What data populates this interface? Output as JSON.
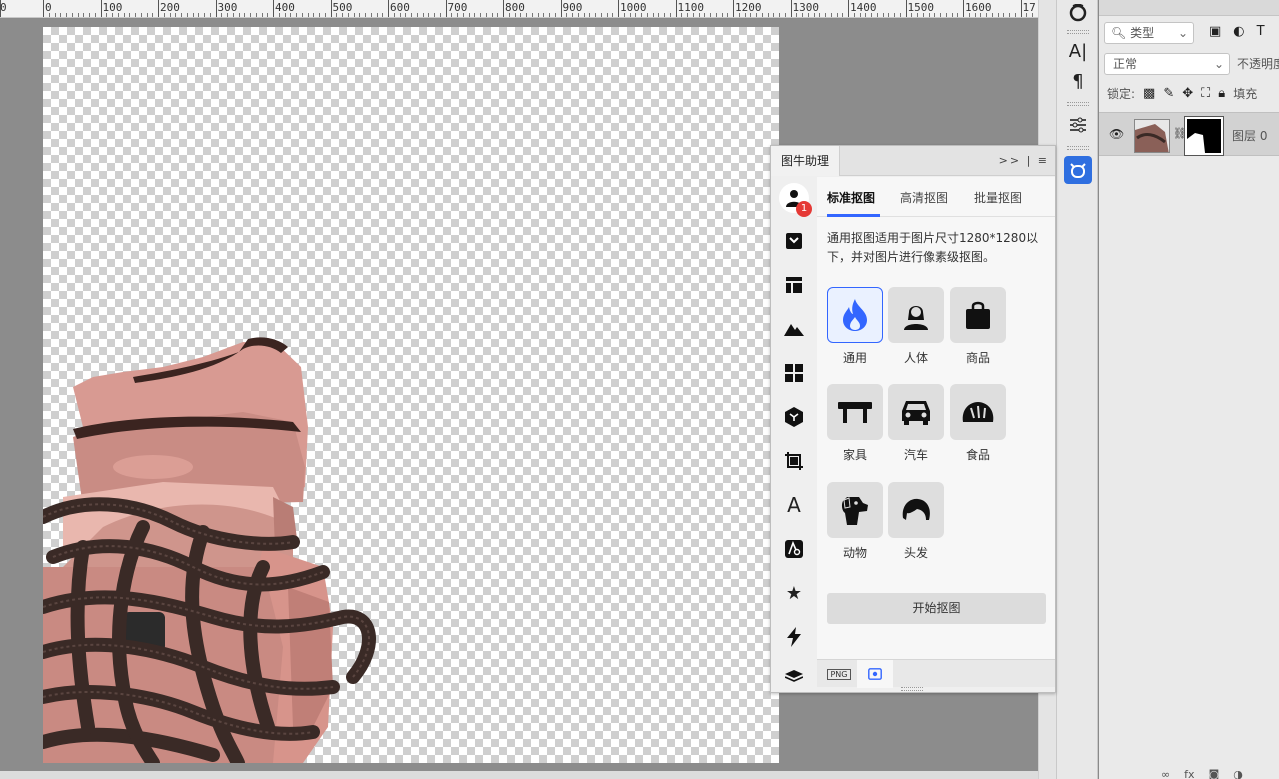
{
  "ruler": {
    "labels": [
      "0",
      "0",
      "100",
      "200",
      "300",
      "400",
      "500",
      "600",
      "700",
      "800",
      "900",
      "1000",
      "1100",
      "1200",
      "1300",
      "1400",
      "1500",
      "1600",
      "17"
    ]
  },
  "plugin": {
    "title": "图牛助理",
    "header_controls": ">> | ≡",
    "badge_count": "1",
    "tabs": [
      {
        "label": "标准抠图",
        "active": true
      },
      {
        "label": "高清抠图",
        "active": false
      },
      {
        "label": "批量抠图",
        "active": false
      }
    ],
    "description": "通用抠图适用于图片尺寸1280*1280以下，并对图片进行像素级抠图。",
    "categories": [
      {
        "label": "通用",
        "icon": "flame-icon",
        "selected": true
      },
      {
        "label": "人体",
        "icon": "person-icon",
        "selected": false
      },
      {
        "label": "商品",
        "icon": "shopping-bag-icon",
        "selected": false
      },
      {
        "label": "家具",
        "icon": "table-icon",
        "selected": false
      },
      {
        "label": "汽车",
        "icon": "car-icon",
        "selected": false
      },
      {
        "label": "食品",
        "icon": "bread-icon",
        "selected": false
      },
      {
        "label": "动物",
        "icon": "dog-icon",
        "selected": false
      },
      {
        "label": "头发",
        "icon": "hair-icon",
        "selected": false
      }
    ],
    "start_button": "开始抠图",
    "footer_png": "PNG",
    "accent_color": "#3366ff",
    "badge_color": "#e53935"
  },
  "layers": {
    "filter_label": "类型",
    "blend_mode": "正常",
    "opacity_label": "不透明度",
    "lock_label": "锁定:",
    "fill_label": "填充",
    "layer_name": "图层 0",
    "bottom_fx": "fx"
  },
  "toolstrip": {
    "text_tool": "A|",
    "paragraph_tool": "¶"
  }
}
